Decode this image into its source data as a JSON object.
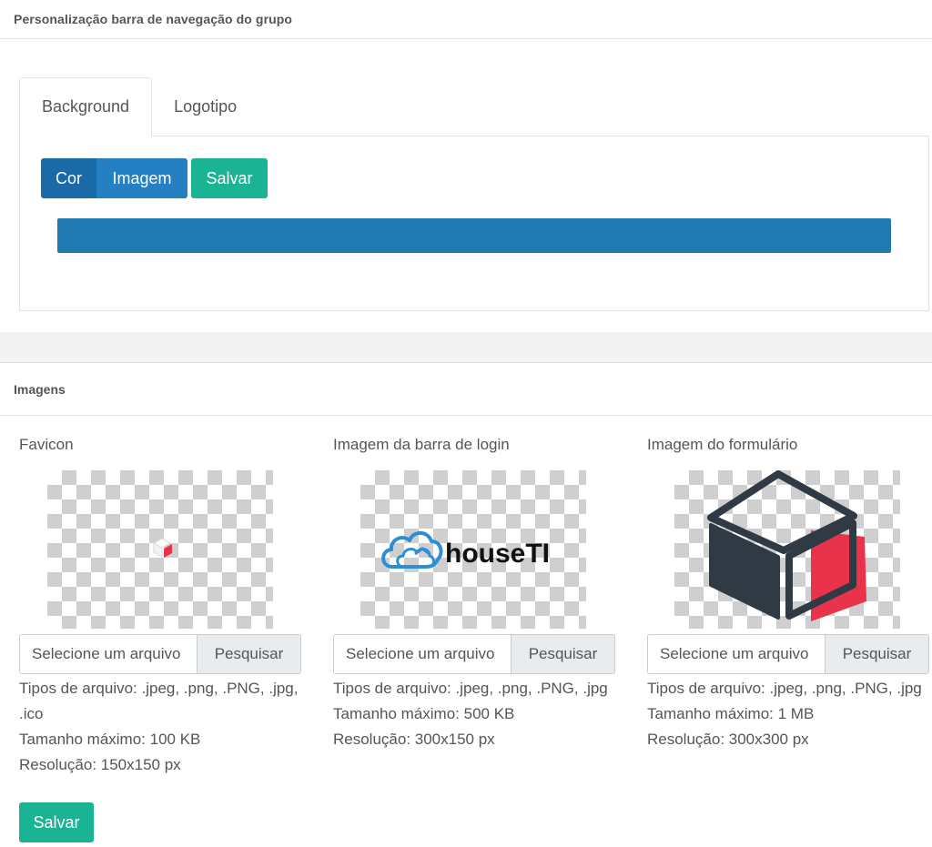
{
  "navbar_section": {
    "title": "Personalização barra de navegação do grupo"
  },
  "tabs": [
    {
      "label": "Background",
      "active": true
    },
    {
      "label": "Logotipo",
      "active": false
    }
  ],
  "background_panel": {
    "cor_label": "Cor",
    "imagem_label": "Imagem",
    "salvar_label": "Salvar",
    "selected_color": "#2079b0"
  },
  "images_section": {
    "title": "Imagens"
  },
  "images": [
    {
      "title": "Favicon",
      "file_placeholder": "Selecione um arquivo",
      "browse_label": "Pesquisar",
      "info_lines": [
        "Tipos de arquivo: .jpeg, .png, .PNG, .jpg, .ico",
        "Tamanho máximo: 100 KB",
        "Resolução: 150x150 px"
      ],
      "preview": "small-cube-icon"
    },
    {
      "title": "Imagem da barra de login",
      "file_placeholder": "Selecione um arquivo",
      "browse_label": "Pesquisar",
      "info_lines": [
        "Tipos de arquivo: .jpeg, .png, .PNG, .jpg",
        "Tamanho máximo: 500 KB",
        "Resolução: 300x150 px"
      ],
      "preview": "houseti-logo",
      "logo_text": "houseTI"
    },
    {
      "title": "Imagem do formulário",
      "file_placeholder": "Selecione um arquivo",
      "browse_label": "Pesquisar",
      "info_lines": [
        "Tipos de arquivo: .jpeg, .png, .PNG, .jpg",
        "Tamanho máximo: 1 MB",
        "Resolução: 300x300 px"
      ],
      "preview": "cube-icon"
    }
  ],
  "footer": {
    "salvar_label": "Salvar"
  },
  "colors": {
    "primary": "#1a6aa8",
    "success": "#1ab394",
    "cube_dark": "#2f3a45",
    "cube_red": "#e8334a",
    "cloud_blue": "#2b8fd6"
  }
}
